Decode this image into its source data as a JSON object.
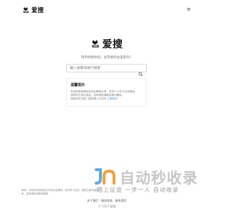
{
  "header": {
    "title": "爱搜",
    "menu_glyph": "≡"
  },
  "hero": {
    "title": "爱搜",
    "subtitle": "简单你那体验，总带要的总里家吗？"
  },
  "search": {
    "placeholder": "输入关键词进行搜索"
  },
  "notice": {
    "title": "温馨提示",
    "lines": [
      "本站所有资源均来自互联网分享，仅供个人学习交流使用，",
      "请勿用于商业用途，如有侵权请联系我们删除，",
      "请用手机扫描二维码跟入口访问"
    ],
    "link_text": "立即访问"
  },
  "watermark": {
    "text": "自动秒收录",
    "sub": "踏上征途 一步一人 自动收录"
  },
  "footer": {
    "note": "声明：本站所有资源及文字来自互联网，仅供学习交流，版权归原作者所有，如有侵权请联系删除。",
    "links": "关于我们 · 服务条款 · 联系我们",
    "copyright": "© 2023 爱搜"
  },
  "colors": {
    "link": "#3b82f6",
    "watermark_blue": "#5aa9e6",
    "watermark_orange": "#f0a23a"
  }
}
